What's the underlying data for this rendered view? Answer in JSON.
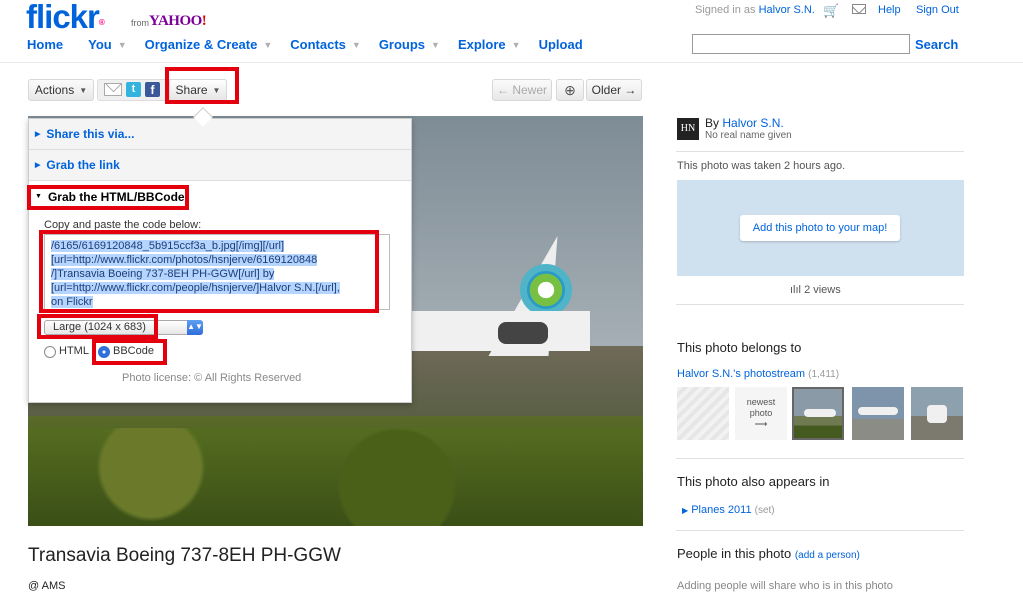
{
  "header": {
    "logo": "flickr",
    "logo_reg": "®",
    "from": "from",
    "yahoo": "YAHOO",
    "yahoo_ex": "!",
    "nav": [
      "Home",
      "You",
      "Organize & Create",
      "Contacts",
      "Groups",
      "Explore",
      "Upload"
    ],
    "signed_in_prefix": "Signed in as",
    "signed_in_user": "Halvor S.N.",
    "help": "Help",
    "sign_out": "Sign Out",
    "search_label": "Search"
  },
  "toolbar": {
    "actions": "Actions",
    "share": "Share",
    "newer": "← Newer",
    "older": "Older →"
  },
  "share_panel": {
    "section_share_via": "Share this via...",
    "section_grab_link": "Grab the link",
    "section_grab_html": "Grab the HTML/BBCode",
    "copy_label": "Copy and paste the code below:",
    "code_lines": [
      "/6165/6169120848_5b915ccf3a_b.jpg[/img][/url]",
      "[url=http://www.flickr.com/photos/hsnjerve/6169120848",
      "/]Transavia Boeing 737-8EH PH-GGW[/url] by",
      "[url=http://www.flickr.com/people/hsnjerve/]Halvor S.N.[/url],",
      "on Flickr"
    ],
    "size_selected": "Large (1024 x 683)",
    "format_html": "HTML",
    "format_bbcode": "BBCode",
    "license": "Photo license: © All Rights Reserved"
  },
  "photo": {
    "title": "Transavia Boeing 737-8EH PH-GGW",
    "location": "@ AMS"
  },
  "sidebar": {
    "buddy_initials": "HN",
    "by_prefix": "By",
    "owner": "Halvor S.N.",
    "no_real_name": "No real name given",
    "taken": "This photo was taken 2 hours ago.",
    "map_button": "Add this photo to your map!",
    "views": "2 views",
    "belongs_header": "This photo belongs to",
    "photostream": "Halvor S.N.'s photostream",
    "photostream_count": "(1,411)",
    "newest_label": "newest photo",
    "newest_arrow": "⟶",
    "appears_header": "This photo also appears in",
    "set_name": "Planes 2011",
    "set_suffix": "(set)",
    "people_header": "People in this photo",
    "add_person": "(add a person)",
    "adding_note": "Adding people will share who is in this photo"
  }
}
